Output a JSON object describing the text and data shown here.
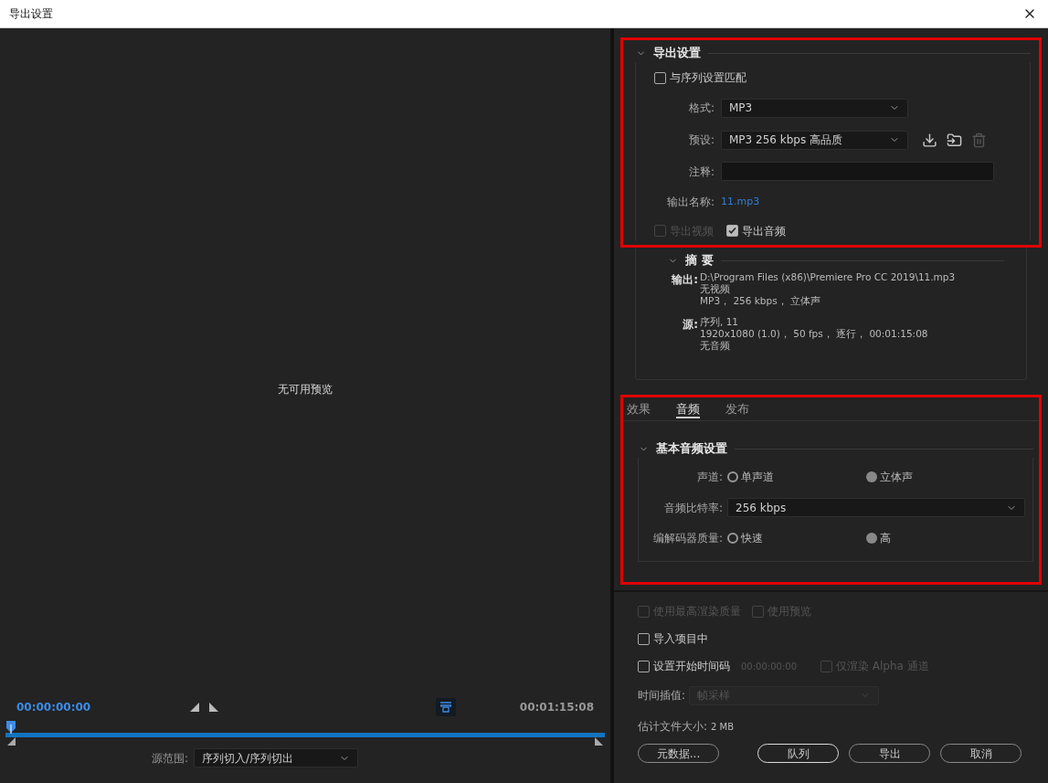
{
  "window": {
    "title": "导出设置"
  },
  "preview": {
    "message": "无可用预览",
    "timecode_start": "00:00:00:00",
    "timecode_end": "00:01:15:08",
    "playhead": {
      "level": 0
    },
    "source_range": {
      "label": "源范围:",
      "value": "序列切入/序列切出"
    }
  },
  "export_settings": {
    "title": "导出设置",
    "expanded": true,
    "highlighted": true,
    "match_sequence": {
      "label": "与序列设置匹配",
      "checked": false
    },
    "format": {
      "label": "格式:",
      "value": "MP3"
    },
    "preset": {
      "label": "预设:",
      "value": "MP3 256 kbps 高品质"
    },
    "comments": {
      "label": "注释:"
    },
    "output_name": {
      "label": "输出名称:",
      "value": "11.mp3"
    },
    "exports": [
      {
        "label": "导出视频",
        "checked": false,
        "disabled": true
      },
      {
        "label": "导出音频",
        "checked": true,
        "disabled": false
      }
    ]
  },
  "summary": {
    "title": "摘 要",
    "expanded": true,
    "groups": [
      {
        "label": "输出:",
        "lines": [
          "D:\\Program Files (x86)\\Premiere Pro CC 2019\\11.mp3",
          "无视频",
          "MP3， 256 kbps， 立体声"
        ]
      },
      {
        "label": "源:",
        "lines": [
          "序列, 11",
          "1920x1080 (1.0)， 50 fps， 逐行， 00:01:15:08",
          "无音频"
        ]
      }
    ]
  },
  "tabs": [
    {
      "label": "效果",
      "selected": false
    },
    {
      "label": "音频",
      "selected": true
    },
    {
      "label": "发布",
      "selected": false
    }
  ],
  "audio_settings": {
    "title": "基本音频设置",
    "expanded": true,
    "highlighted": true,
    "rows": [
      {
        "kind": "radio",
        "label": "声道:",
        "options": [
          {
            "label": "单声道",
            "selected": false
          },
          {
            "label": "立体声",
            "selected": true
          }
        ]
      },
      {
        "kind": "select",
        "label": "音频比特率:",
        "value": "256 kbps"
      },
      {
        "kind": "radio",
        "label": "编解码器质量:",
        "options": [
          {
            "label": "快速",
            "selected": false
          },
          {
            "label": "高",
            "selected": true
          }
        ]
      }
    ]
  },
  "option_rows": [
    {
      "items": [
        {
          "kind": "checkbox",
          "label": "使用最高渲染质量",
          "checked": false,
          "disabled": true
        },
        {
          "kind": "checkbox",
          "label": "使用预览",
          "checked": false,
          "disabled": true
        }
      ]
    },
    {
      "items": [
        {
          "kind": "checkbox",
          "label": "导入项目中",
          "checked": false,
          "disabled": false
        }
      ]
    },
    {
      "items": [
        {
          "kind": "checkbox",
          "label": "设置开始时间码",
          "checked": false,
          "disabled": false
        },
        {
          "kind": "timecode",
          "label": "00:00:00:00",
          "disabled": true
        },
        {
          "kind": "checkbox",
          "label": "仅渲染 Alpha 通道",
          "checked": false,
          "disabled": true
        }
      ]
    }
  ],
  "time_interpolation": {
    "label": "时间插值:",
    "value": "帧采样",
    "disabled": true
  },
  "file_size": {
    "label": "估计文件大小:",
    "value": "2 MB"
  },
  "buttons": [
    {
      "label": "元数据...",
      "default": false
    },
    {
      "label": "队列",
      "default": true
    },
    {
      "label": "导出",
      "default": false
    },
    {
      "label": "取消",
      "default": false
    }
  ]
}
